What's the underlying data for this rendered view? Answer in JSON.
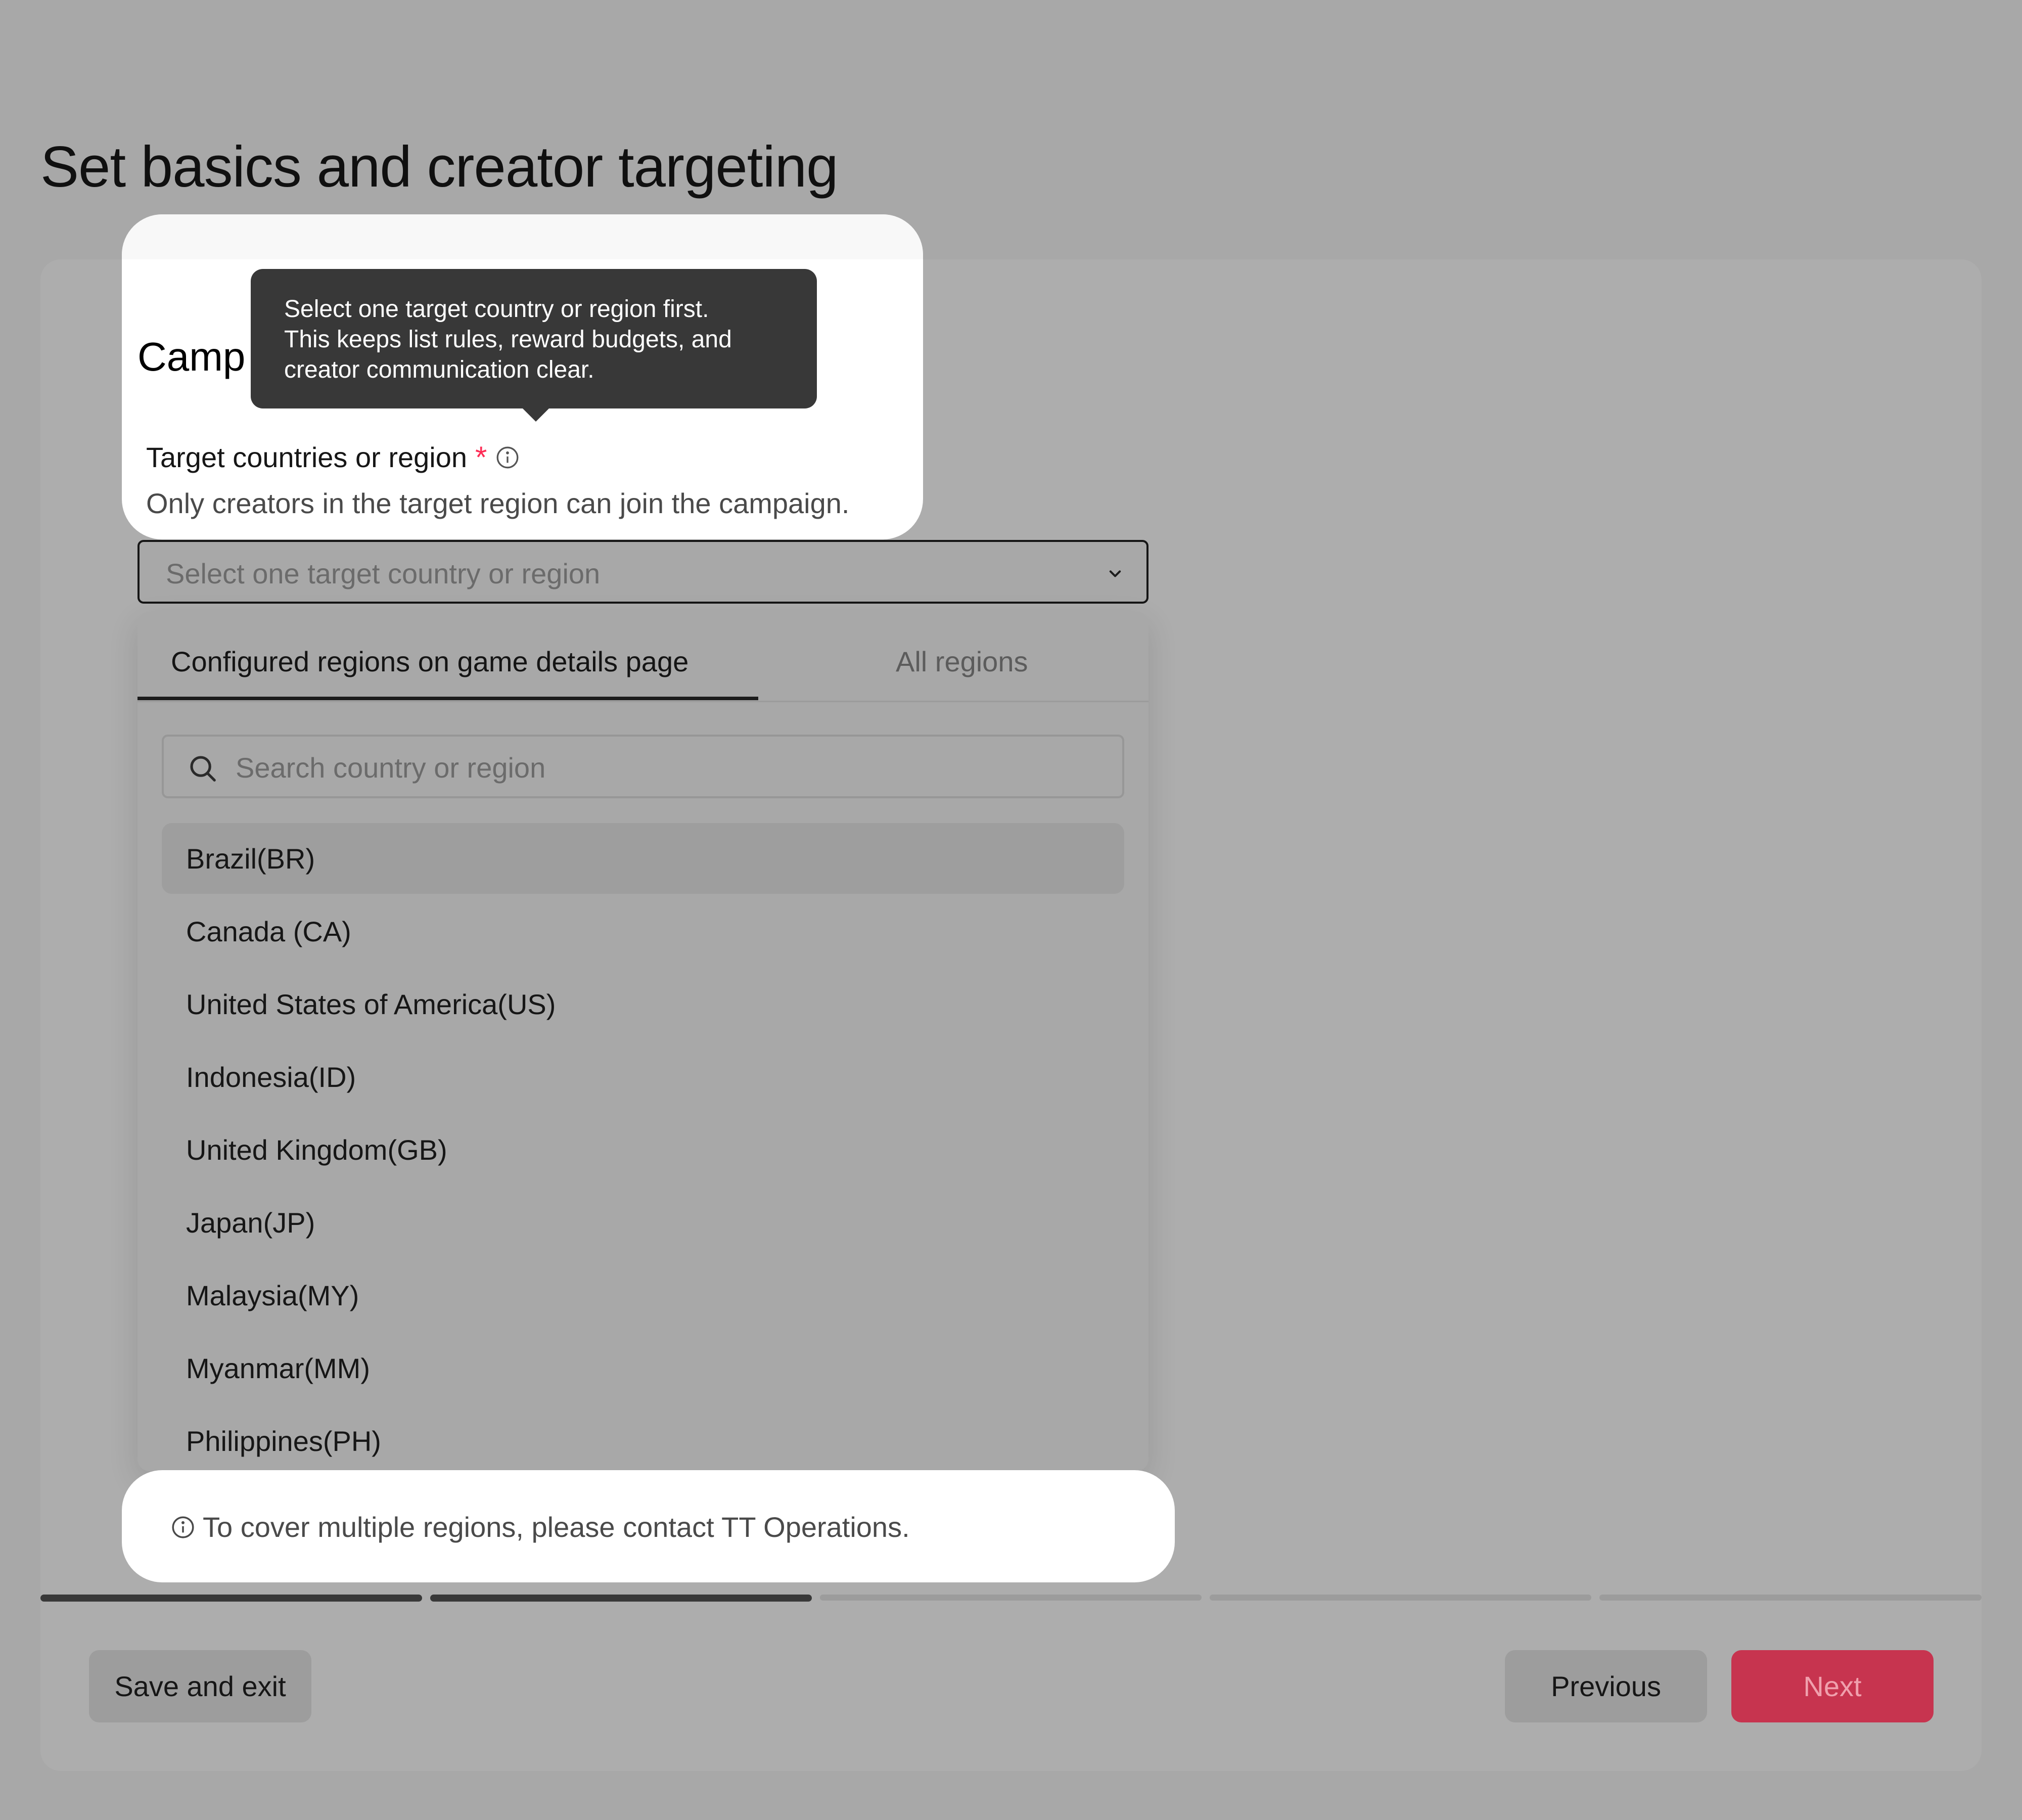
{
  "page": {
    "title": "Set basics and creator targeting"
  },
  "section": {
    "title_visible": "Camp"
  },
  "field": {
    "label": "Target countries or region",
    "required_mark": "*",
    "help_text": "Only creators in the target region can join the campaign.",
    "info_icon": "info-circle-icon"
  },
  "tooltip": {
    "lines": [
      "Select one target country or region first.",
      "This keeps list rules, reward budgets, and",
      "creator communication clear."
    ]
  },
  "select": {
    "placeholder": "Select one target country or region",
    "chevron_icon": "chevron-down-icon"
  },
  "dropdown": {
    "tabs": [
      {
        "label": "Configured regions on game details page",
        "active": true
      },
      {
        "label": "All regions",
        "active": false
      }
    ],
    "search": {
      "placeholder": "Search country or region",
      "icon": "search-icon"
    },
    "options": [
      "Brazil(BR)",
      "Canada (CA)",
      "United States of America(US)",
      "Indonesia(ID)",
      "United Kingdom(GB)",
      "Japan(JP)",
      "Malaysia(MY)",
      "Myanmar(MM)",
      "Philippines(PH)"
    ],
    "hovered_option": "Brazil(BR)"
  },
  "notice": {
    "text": "To cover multiple regions, please contact TT Operations.",
    "icon": "info-circle-icon"
  },
  "progress": {
    "total_steps": 5,
    "completed_steps": 2
  },
  "footer": {
    "save_label": "Save and exit",
    "previous_label": "Previous",
    "next_label": "Next"
  },
  "colors": {
    "accent": "#fe2c55",
    "next_button": "#c7344f",
    "tooltip_bg": "#383838",
    "overlay": "#a8a8a8"
  }
}
